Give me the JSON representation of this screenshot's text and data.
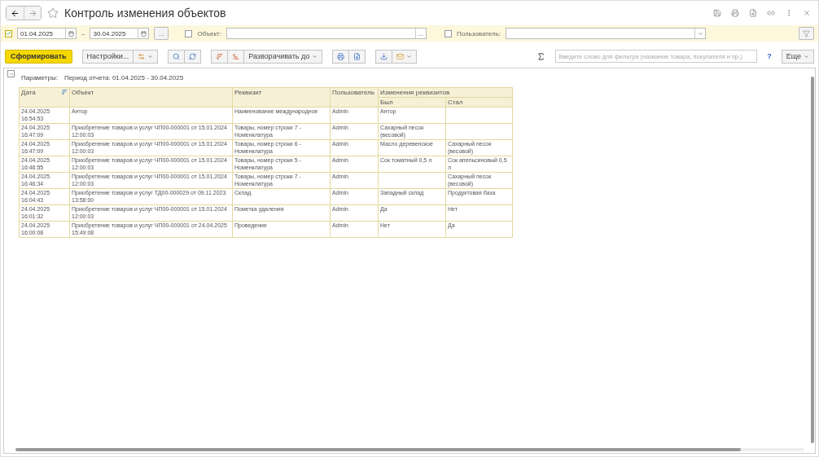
{
  "window": {
    "title": "Контроль изменения объектов",
    "favorite": false
  },
  "filters": {
    "period": {
      "checked": true,
      "date_from": "01.04.2025",
      "separator": "–",
      "date_to": "30.04.2025",
      "more": "..."
    },
    "object": {
      "checked": false,
      "label": "Объект:",
      "more": "..."
    },
    "user": {
      "checked": false,
      "label": "Пользователь:"
    }
  },
  "toolbar": {
    "generate": "Сформировать",
    "settings": "Настройки...",
    "expand": "Разворачивать до",
    "search_placeholder": "Введите слово для фильтра (название товара, покупателя и пр.)",
    "help": "?",
    "more": "Еще"
  },
  "report": {
    "params_label": "Параметры:",
    "params_value": "Период отчета: 01.04.2025 - 30.04.2025",
    "columns": [
      "Дата",
      "Объект",
      "Реквизит",
      "Пользователь"
    ],
    "group_column": "Изменения реквизитов",
    "subcolumns": [
      "Был",
      "Стал"
    ],
    "rows": [
      {
        "date": "24.04.2025 16:54:53",
        "object": "Антор",
        "attribute": "Наименование международное",
        "user": "Admin",
        "was": "Антор",
        "became": ""
      },
      {
        "date": "24.04.2025 16:47:09",
        "object": "Приобретение товаров и услуг ЧП00-000001 от 15.01.2024 12:00:03",
        "attribute": "Товары, номер строки 7 - Номенклатура",
        "user": "Admin",
        "was": "Сахарный песок (весовой)",
        "became": ""
      },
      {
        "date": "24.04.2025 16:47:09",
        "object": "Приобретение товаров и услуг ЧП00-000001 от 15.01.2024 12:00:03",
        "attribute": "Товары, номер строки 6 - Номенклатура",
        "user": "Admin",
        "was": "Масло деревенское",
        "became": "Сахарный песок (весовой)"
      },
      {
        "date": "24.04.2025 16:46:55",
        "object": "Приобретение товаров и услуг ЧП00-000001 от 15.01.2024 12:00:03",
        "attribute": "Товары, номер строки 5 - Номенклатура",
        "user": "Admin",
        "was": "Сок томатный 0,5 л",
        "became": "Сок апельсиновый 0,5 л"
      },
      {
        "date": "24.04.2025 16:46:34",
        "object": "Приобретение товаров и услуг ЧП00-000001 от 15.01.2024 12:00:03",
        "attribute": "Товары, номер строки 7 - Номенклатура",
        "user": "Admin",
        "was": "",
        "became": "Сахарный песок (весовой)"
      },
      {
        "date": "24.04.2025 16:04:43",
        "object": "Приобретение товаров и услуг ТД00-000029 от 09.11.2023 13:58:00",
        "attribute": "Склад",
        "user": "Admin",
        "was": "Западный склад",
        "became": "Продуктовая база"
      },
      {
        "date": "24.04.2025 16:01:32",
        "object": "Приобретение товаров и услуг ЧП00-000001 от 15.01.2024 12:00:03",
        "attribute": "Пометка удаления",
        "user": "Admin",
        "was": "Да",
        "became": "Нет"
      },
      {
        "date": "24.04.2025 16:00:08",
        "object": "Приобретение товаров и услуг ЧП00-000001 от 24.04.2025 15:49:08",
        "attribute": "Проведение",
        "user": "Admin",
        "was": "Нет",
        "became": "Да"
      }
    ]
  }
}
